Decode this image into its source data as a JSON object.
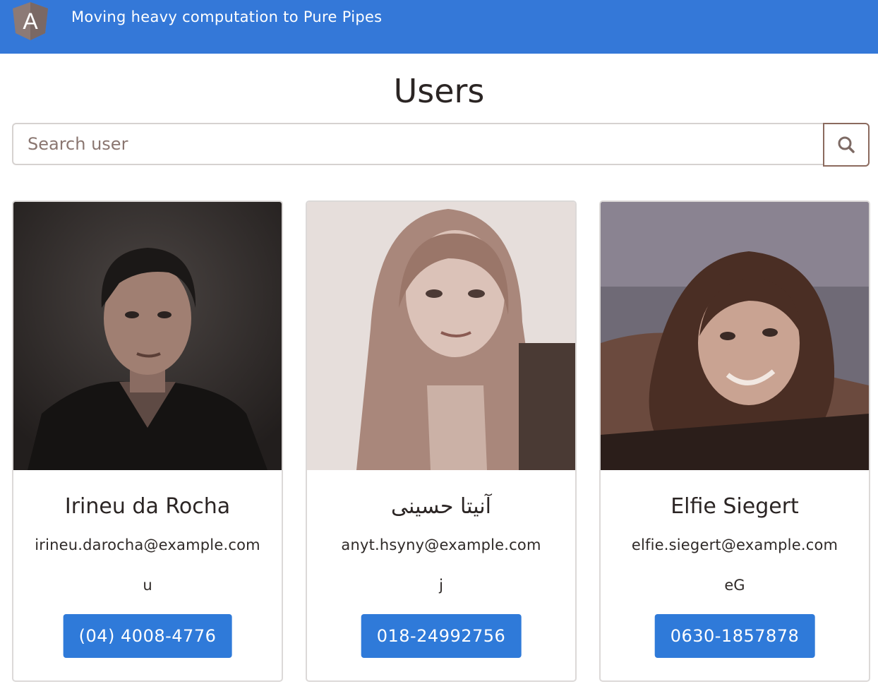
{
  "header": {
    "app_title": "Moving heavy computation to Pure Pipes",
    "logo_letter": "A",
    "color": "#3478d8"
  },
  "page": {
    "title": "Users"
  },
  "search": {
    "placeholder": "Search user",
    "value": "",
    "icon": "search-icon"
  },
  "users": [
    {
      "name": "Irineu da Rocha",
      "email": "irineu.darocha@example.com",
      "nat": "u",
      "phone": "(04) 4008-4776"
    },
    {
      "name": "آنیتا حسینی",
      "email": "anyt.hsyny@example.com",
      "nat": "j",
      "phone": "018-24992756"
    },
    {
      "name": "Elfie Siegert",
      "email": "elfie.siegert@example.com",
      "nat": "eG",
      "phone": "0630-1857878"
    }
  ],
  "colors": {
    "accent": "#2f7ad9",
    "search_border": "#8b6a5e"
  }
}
